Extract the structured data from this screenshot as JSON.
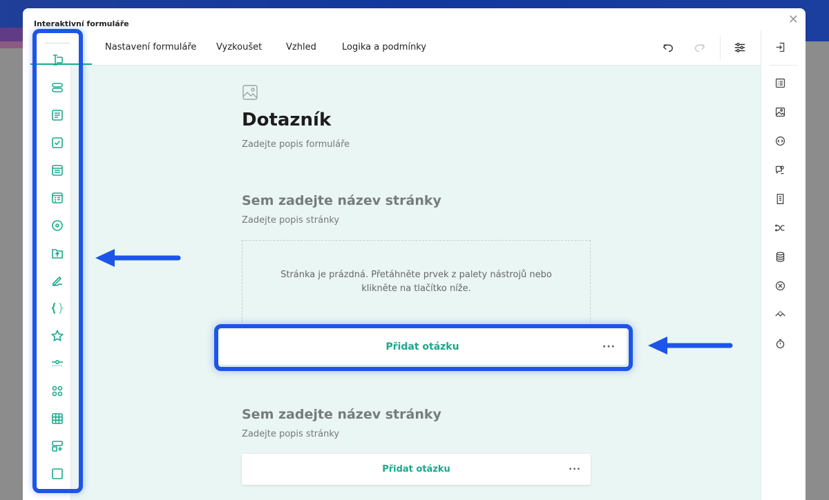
{
  "window": {
    "title": "Interaktivní formuláře",
    "close_symbol": "✕"
  },
  "tabs": [
    {
      "label": "Nastavení formuláře"
    },
    {
      "label": "Vyzkoušet"
    },
    {
      "label": "Vzhled"
    },
    {
      "label": "Logika a podmínky"
    }
  ],
  "toolbar": {
    "icons": [
      "undo-icon",
      "redo-icon",
      "settings-sliders-icon"
    ]
  },
  "palette": {
    "icons": [
      "text-input-icon",
      "multiple-text-icon",
      "comment-icon",
      "checkbox-icon",
      "dropdown-icon",
      "tagbox-icon",
      "radio-icon",
      "file-upload-icon",
      "signature-icon",
      "expression-icon",
      "rating-icon",
      "slider-icon",
      "image-picker-icon",
      "matrix-icon",
      "dynamic-panel-icon",
      "panel-icon"
    ]
  },
  "form": {
    "title": "Dotazník",
    "description": "Zadejte popis formuláře"
  },
  "pages": [
    {
      "title": "Sem zadejte název stránky",
      "description": "Zadejte popis stránky",
      "empty_message": "Stránka je prázdná. Přetáhněte prvek z palety nástrojů nebo klikněte na tlačítko níže.",
      "add_question": "Přidat otázku",
      "more": "···"
    },
    {
      "title": "Sem zadejte název stránky",
      "description": "Zadejte popis stránky",
      "add_question": "Přidat otázku",
      "more": "···"
    }
  ],
  "right_sidebar": {
    "icons": [
      "exit-icon",
      "list-icon",
      "image-icon",
      "code-icon",
      "chat-settings-icon",
      "document-icon",
      "shuffle-icon",
      "database-icon",
      "cancel-icon",
      "connector-icon",
      "timer-icon"
    ]
  },
  "colors": {
    "accent": "#19a98b",
    "highlight": "#1c55e8",
    "canvas": "#eaf6f3"
  }
}
